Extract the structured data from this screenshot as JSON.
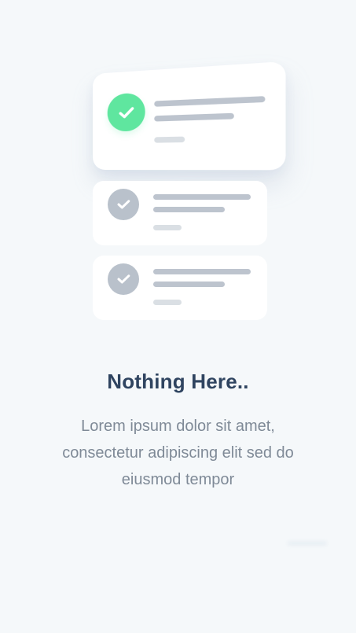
{
  "empty_state": {
    "title": "Nothing Here..",
    "description": "Lorem ipsum dolor sit amet, consectetur adipiscing elit sed do eiusmod tempor"
  },
  "illustration": {
    "cards": [
      {
        "icon": "check-icon",
        "status_color": "#5fe69f"
      },
      {
        "icon": "check-icon",
        "status_color": "#b9c1cb"
      },
      {
        "icon": "check-icon",
        "status_color": "#b9c1cb"
      }
    ]
  },
  "theme": {
    "background": "#f5f8fa",
    "card": "#ffffff",
    "title_color": "#2f4460",
    "text_color": "#7f8a97",
    "line_color": "#bdc4ce",
    "light_line_color": "#dadfe4"
  }
}
